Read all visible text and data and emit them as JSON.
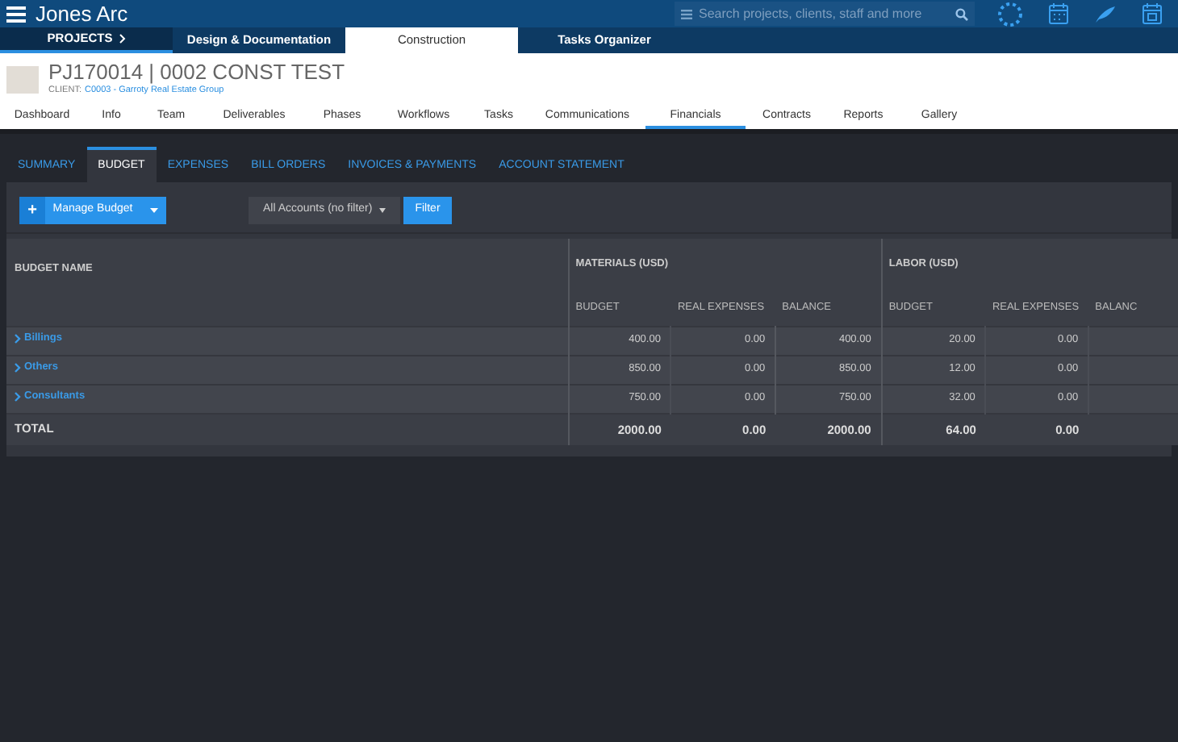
{
  "app": {
    "title": "Jones Arc",
    "search_placeholder": "Search projects, clients, staff and more"
  },
  "module_tabs": [
    {
      "label": "PROJECTS",
      "kind": "projects",
      "selected": false
    },
    {
      "label": "Design & Documentation",
      "kind": "tab",
      "selected": false
    },
    {
      "label": "Construction",
      "kind": "tab",
      "selected": true
    },
    {
      "label": "Tasks Organizer",
      "kind": "tab",
      "selected": false
    }
  ],
  "project": {
    "title": "PJ170014 | 0002 CONST TEST",
    "client_label": "CLIENT:",
    "client": "C0003 - Garroty Real Estate Group"
  },
  "nav_tabs": [
    {
      "label": "Dashboard",
      "selected": false
    },
    {
      "label": "Info",
      "selected": false
    },
    {
      "label": "Team",
      "selected": false
    },
    {
      "label": "Deliverables",
      "selected": false
    },
    {
      "label": "Phases",
      "selected": false
    },
    {
      "label": "Workflows",
      "selected": false
    },
    {
      "label": "Tasks",
      "selected": false
    },
    {
      "label": "Communications",
      "selected": false
    },
    {
      "label": "Financials",
      "selected": true
    },
    {
      "label": "Contracts",
      "selected": false
    },
    {
      "label": "Reports",
      "selected": false
    },
    {
      "label": "Gallery",
      "selected": false
    }
  ],
  "sub_tabs": [
    {
      "label": "SUMMARY",
      "selected": false
    },
    {
      "label": "BUDGET",
      "selected": true
    },
    {
      "label": "EXPENSES",
      "selected": false
    },
    {
      "label": "BILL ORDERS",
      "selected": false
    },
    {
      "label": "INVOICES & PAYMENTS",
      "selected": false
    },
    {
      "label": "ACCOUNT STATEMENT",
      "selected": false
    }
  ],
  "toolbar": {
    "plus": "+",
    "manage_button": "Manage Budget",
    "filter_select": "All Accounts (no filter)",
    "filter_button": "Filter"
  },
  "table": {
    "name_column": "BUDGET NAME",
    "groups": [
      {
        "label": "MATERIALS (USD)",
        "columns": [
          "BUDGET",
          "REAL EXPENSES",
          "BALANCE"
        ]
      },
      {
        "label": "LABOR (USD)",
        "columns": [
          "BUDGET",
          "REAL EXPENSES",
          "BALANC"
        ]
      }
    ],
    "rows": [
      {
        "name": "Billings",
        "cells": [
          "400.00",
          "0.00",
          "400.00",
          "20.00",
          "0.00"
        ]
      },
      {
        "name": "Others",
        "cells": [
          "850.00",
          "0.00",
          "850.00",
          "12.00",
          "0.00"
        ]
      },
      {
        "name": "Consultants",
        "cells": [
          "750.00",
          "0.00",
          "750.00",
          "32.00",
          "0.00"
        ]
      }
    ],
    "total": {
      "name": "TOTAL",
      "cells": [
        "2000.00",
        "0.00",
        "2000.00",
        "64.00",
        "0.00"
      ]
    }
  }
}
